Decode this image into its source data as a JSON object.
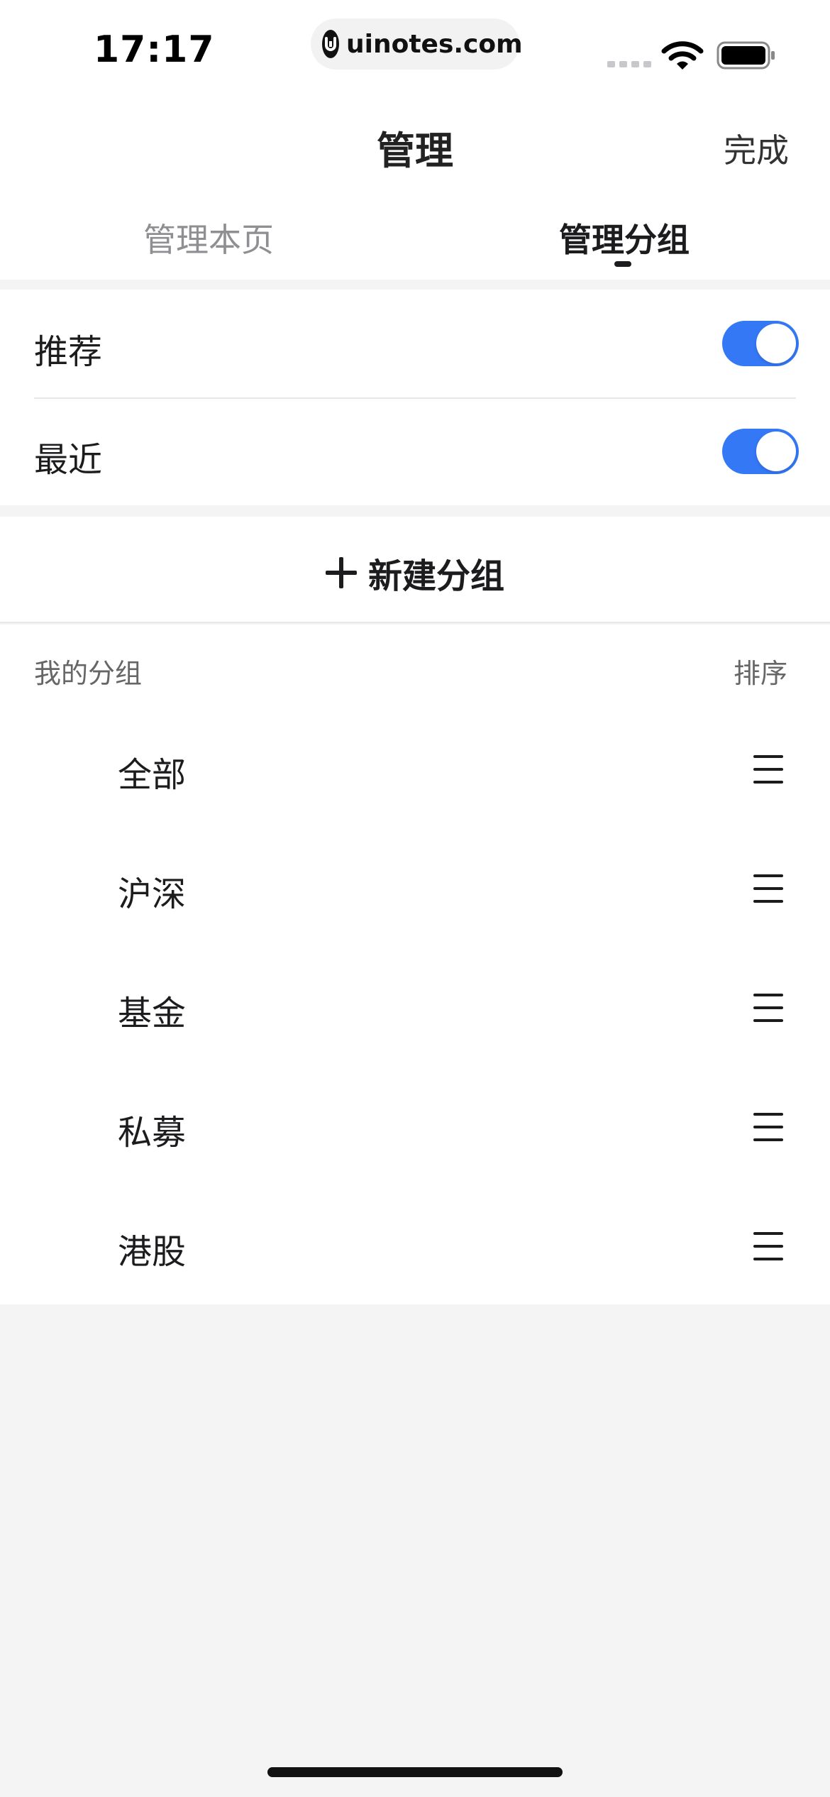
{
  "status_bar": {
    "time": "17:17",
    "url": "uinotes.com",
    "logo_letter": "U",
    "signal_icon": "cellular-signal-icon",
    "wifi_icon": "wifi-icon",
    "battery_icon": "battery-icon"
  },
  "nav": {
    "title": "管理",
    "done_label": "完成"
  },
  "tabs": {
    "items": [
      {
        "label": "管理本页",
        "active": false
      },
      {
        "label": "管理分组",
        "active": true
      }
    ]
  },
  "toggles": {
    "items": [
      {
        "label": "推荐",
        "on": true
      },
      {
        "label": "最近",
        "on": true
      }
    ]
  },
  "new_group": {
    "icon": "plus-icon",
    "label": "新建分组"
  },
  "groups": {
    "title": "我的分组",
    "sort_label": "排序",
    "drag_icon": "drag-handle-icon",
    "items": [
      {
        "name": "全部"
      },
      {
        "name": "沪深"
      },
      {
        "name": "基金"
      },
      {
        "name": "私募"
      },
      {
        "name": "港股"
      }
    ]
  },
  "colors": {
    "accent": "#3478f6",
    "background": "#f4f4f5",
    "card": "#ffffff",
    "text": "#1c1c1e",
    "muted": "#8e8e93"
  }
}
